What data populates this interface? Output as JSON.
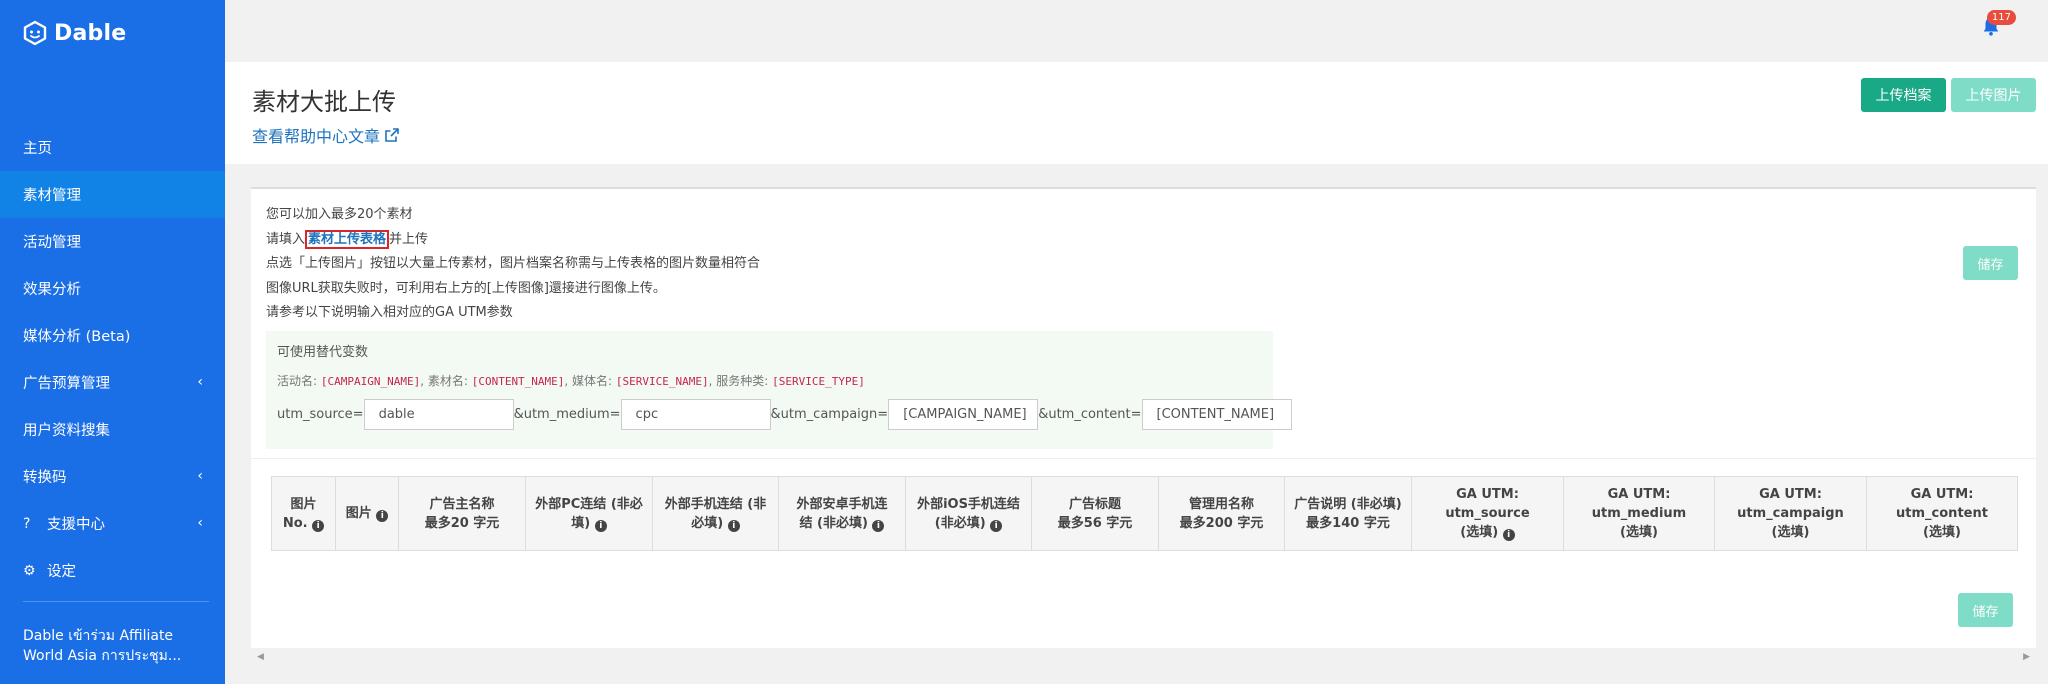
{
  "brand": {
    "name": "Dable"
  },
  "sidebar": {
    "items": [
      {
        "label": "主页",
        "active": false
      },
      {
        "label": "素材管理",
        "active": true
      },
      {
        "label": "活动管理",
        "active": false
      },
      {
        "label": "效果分析",
        "active": false
      },
      {
        "label": "媒体分析 (Beta)",
        "active": false
      },
      {
        "label": "广告预算管理",
        "active": false,
        "expandable": true
      },
      {
        "label": "用户资料搜集",
        "active": false
      },
      {
        "label": "转换码",
        "active": false,
        "expandable": true
      },
      {
        "label": "支援中心",
        "active": false,
        "expandable": true,
        "icon": "question-icon"
      },
      {
        "label": "设定",
        "active": false,
        "icon": "gear-icon"
      }
    ],
    "news_line1": "Dable เข้าร่วม Affiliate",
    "news_line2": "World Asia การประชุม..."
  },
  "topbar": {
    "notification_count": "117",
    "icon": "bell-icon"
  },
  "header": {
    "title": "素材大批上传",
    "help_link": "查看帮助中心文章",
    "upload_file_button": "上传档案",
    "upload_image_button": "上传图片"
  },
  "info": {
    "line1": "您可以加入最多20个素材",
    "line2_prefix": "请填入",
    "line2_link": "素材上传表格",
    "line2_suffix": "并上传",
    "line3": "点选「上传图片」按钮以大量上传素材，图片档案名称需与上传表格的图片数量相符合",
    "line4": "图像URL获取失败时，可利用右上方的[上传图像]還接进行图像上传。",
    "line5": "请参考以下说明输入相对应的GA UTM参数"
  },
  "save_label": "储存",
  "variables": {
    "title": "可使用替代变数",
    "campaign_label": "活动名: ",
    "campaign_code": "[CAMPAIGN_NAME]",
    "content_label": ", 素材名: ",
    "content_code": "[CONTENT_NAME]",
    "media_label": ", 媒体名: ",
    "media_code": "[SERVICE_NAME]",
    "service_label": ", 服务种类: ",
    "service_code": "[SERVICE_TYPE]"
  },
  "utm": {
    "source_label": "utm_source=",
    "source_value": "dable",
    "medium_label": "&utm_medium=",
    "medium_value": "cpc",
    "campaign_label": "&utm_campaign=",
    "campaign_value": "[CAMPAIGN_NAME]",
    "content_label": "&utm_content=",
    "content_value": "[CONTENT_NAME]"
  },
  "table": {
    "columns": [
      {
        "l1": "图片",
        "l2": "No.",
        "info": true
      },
      {
        "l1": "图片",
        "l2": "",
        "info": true
      },
      {
        "l1": "广告主名称",
        "l2": "最多20 字元",
        "info": false
      },
      {
        "l1": "外部PC连结 (非必",
        "l2": "填)",
        "info": true
      },
      {
        "l1": "外部手机连结 (非",
        "l2": "必填)",
        "info": true
      },
      {
        "l1": "外部安卓手机连",
        "l2": "结 (非必填)",
        "info": true
      },
      {
        "l1": "外部iOS手机连结",
        "l2": "(非必填)",
        "info": true
      },
      {
        "l1": "广告标题",
        "l2": "最多56 字元",
        "info": false
      },
      {
        "l1": "管理用名称",
        "l2": "最多200 字元",
        "info": false
      },
      {
        "l1": "广告说明 (非必填)",
        "l2": "最多140 字元",
        "info": false
      },
      {
        "l1": "GA UTM:",
        "l2": "utm_source",
        "l3": "(选填)",
        "info": true
      },
      {
        "l1": "GA UTM:",
        "l2": "utm_medium",
        "l3": "(选填)",
        "info": false
      },
      {
        "l1": "GA UTM:",
        "l2": "utm_campaign",
        "l3": "(选填)",
        "info": false
      },
      {
        "l1": "GA UTM:",
        "l2": "utm_content",
        "l3": "(选填)",
        "info": false
      }
    ]
  }
}
